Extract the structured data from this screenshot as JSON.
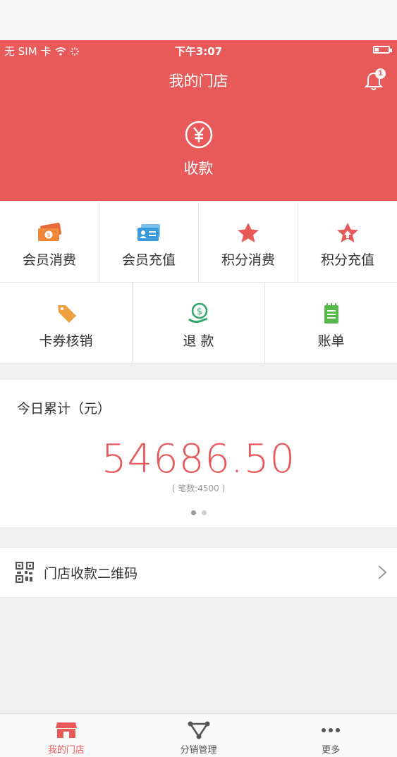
{
  "status": {
    "carrier": "无 SIM 卡",
    "time": "下午3:07",
    "battery_level": 0.3
  },
  "header": {
    "title": "我的门店",
    "notification_count": "1",
    "collect_label": "收款"
  },
  "grid_row1": [
    {
      "label": "会员消费",
      "icon": "cash-icon"
    },
    {
      "label": "会员充值",
      "icon": "member-card-icon"
    },
    {
      "label": "积分消费",
      "icon": "star-icon"
    },
    {
      "label": "积分充值",
      "icon": "star-up-icon"
    }
  ],
  "grid_row2": [
    {
      "label": "卡券核销",
      "icon": "tag-icon"
    },
    {
      "label": "退 款",
      "icon": "refund-icon"
    },
    {
      "label": "账单",
      "icon": "bill-icon"
    }
  ],
  "today": {
    "title": "今日累计（元）",
    "amount": "54686.50",
    "count": "( 笔数:4500 )"
  },
  "qr": {
    "label": "门店收款二维码"
  },
  "tabs": [
    {
      "label": "我的门店",
      "icon": "store-icon",
      "active": true
    },
    {
      "label": "分销管理",
      "icon": "distribution-icon",
      "active": false
    },
    {
      "label": "更多",
      "icon": "more-icon",
      "active": false
    }
  ],
  "colors": {
    "primary": "#e85a5a",
    "orange": "#f0883a",
    "blue": "#3a9ad9",
    "green": "#2ea86b",
    "light_green": "#56b84a"
  }
}
